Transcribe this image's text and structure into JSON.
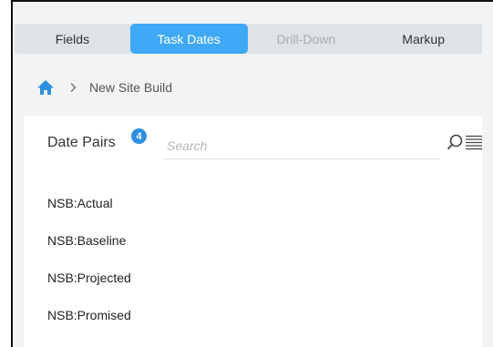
{
  "tabs": [
    {
      "label": "Fields",
      "state": "normal"
    },
    {
      "label": "Task Dates",
      "state": "active"
    },
    {
      "label": "Drill-Down",
      "state": "disabled"
    },
    {
      "label": "Markup",
      "state": "normal"
    }
  ],
  "breadcrumb": {
    "home_icon": "home-icon",
    "separator_icon": "chevron-right-icon",
    "current": "New Site Build"
  },
  "panel": {
    "title": "Date Pairs",
    "badge_count": "4",
    "search": {
      "placeholder": "Search",
      "value": ""
    },
    "items": [
      "NSB:Actual",
      "NSB:Baseline",
      "NSB:Projected",
      "NSB:Promised"
    ]
  },
  "colors": {
    "accent": "#3fa9f5",
    "badge": "#2d8fe0",
    "tabbar_bg": "#dfe3e8",
    "page_bg": "#f2f3f5",
    "disabled_text": "#a9adb3"
  }
}
